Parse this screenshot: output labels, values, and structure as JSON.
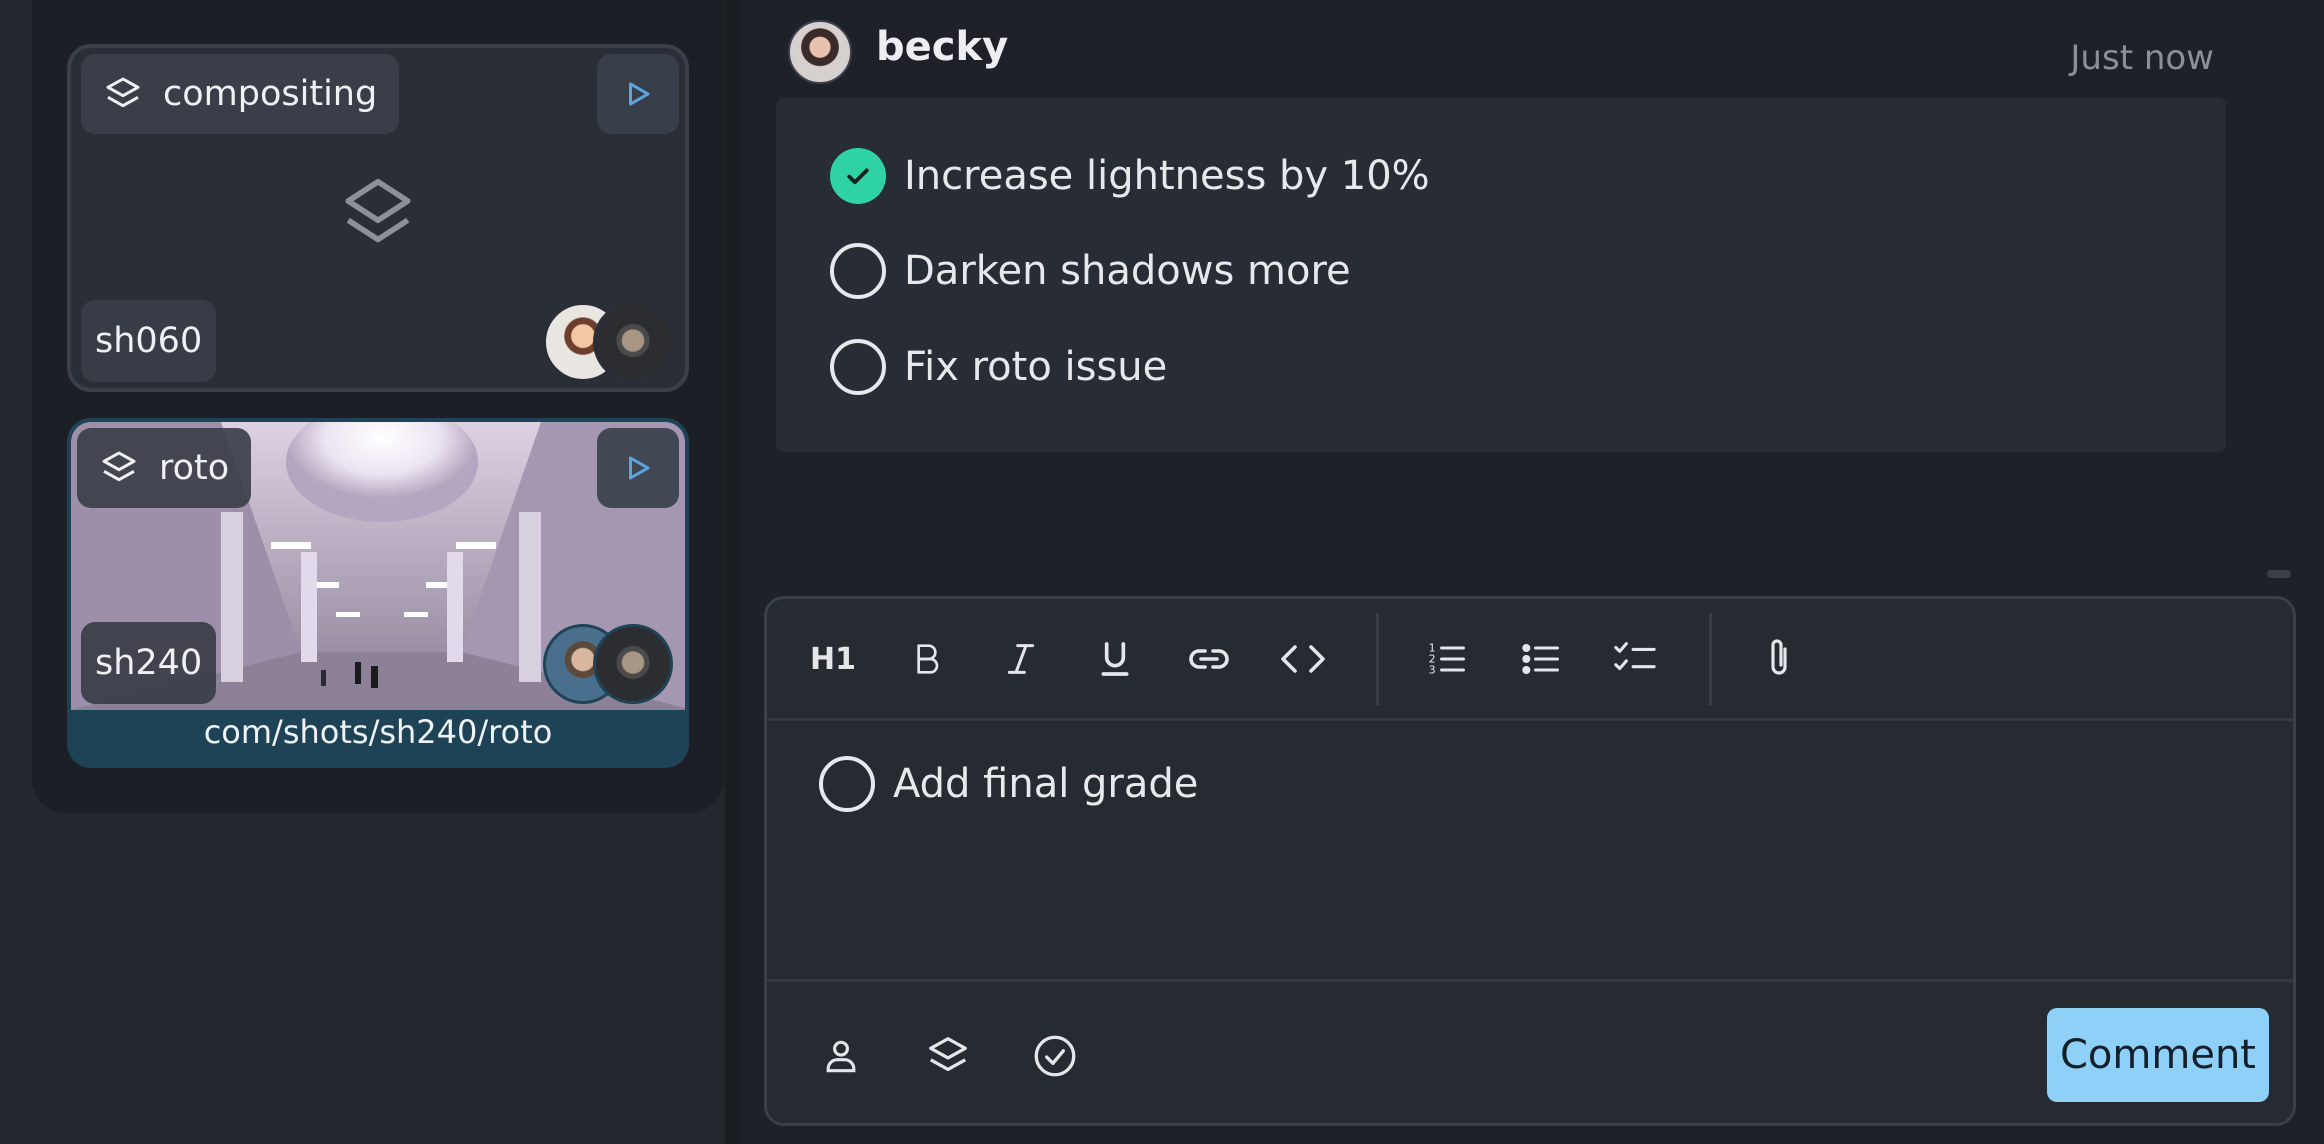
{
  "shots": [
    {
      "task": "compositing",
      "shot": "sh060",
      "has_thumbnail": false,
      "task_icon": "layers-icon",
      "play_icon": "play-icon"
    },
    {
      "task": "roto",
      "shot": "sh240",
      "has_thumbnail": true,
      "path": "com/shots/sh240/roto",
      "task_icon": "layers-icon",
      "play_icon": "play-icon"
    }
  ],
  "comment": {
    "author": "becky",
    "timestamp": "Just now",
    "tasks": [
      {
        "label": "Increase lightness by 10%",
        "done": true
      },
      {
        "label": "Darken shadows more",
        "done": false
      },
      {
        "label": "Fix roto issue",
        "done": false
      }
    ]
  },
  "editor": {
    "toolbar": [
      {
        "name": "heading",
        "label": "H1"
      },
      {
        "name": "bold",
        "icon": "bold-icon"
      },
      {
        "name": "italic",
        "icon": "italic-icon"
      },
      {
        "name": "underline",
        "icon": "underline-icon"
      },
      {
        "name": "link",
        "icon": "link-icon"
      },
      {
        "name": "code",
        "icon": "code-icon"
      },
      {
        "name": "ordered-list",
        "icon": "ordered-list-icon"
      },
      {
        "name": "bullet-list",
        "icon": "bullet-list-icon"
      },
      {
        "name": "task-list",
        "icon": "task-list-icon"
      },
      {
        "name": "attach",
        "icon": "paperclip-icon"
      }
    ],
    "draft_task": "Add final grade",
    "footer_icons": [
      "user-icon",
      "layers-icon",
      "check-circle-icon"
    ],
    "submit_label": "Comment"
  },
  "colors": {
    "accent": "#8fd0f8",
    "done": "#2fd3a3",
    "selected_card": "#1e4356"
  }
}
